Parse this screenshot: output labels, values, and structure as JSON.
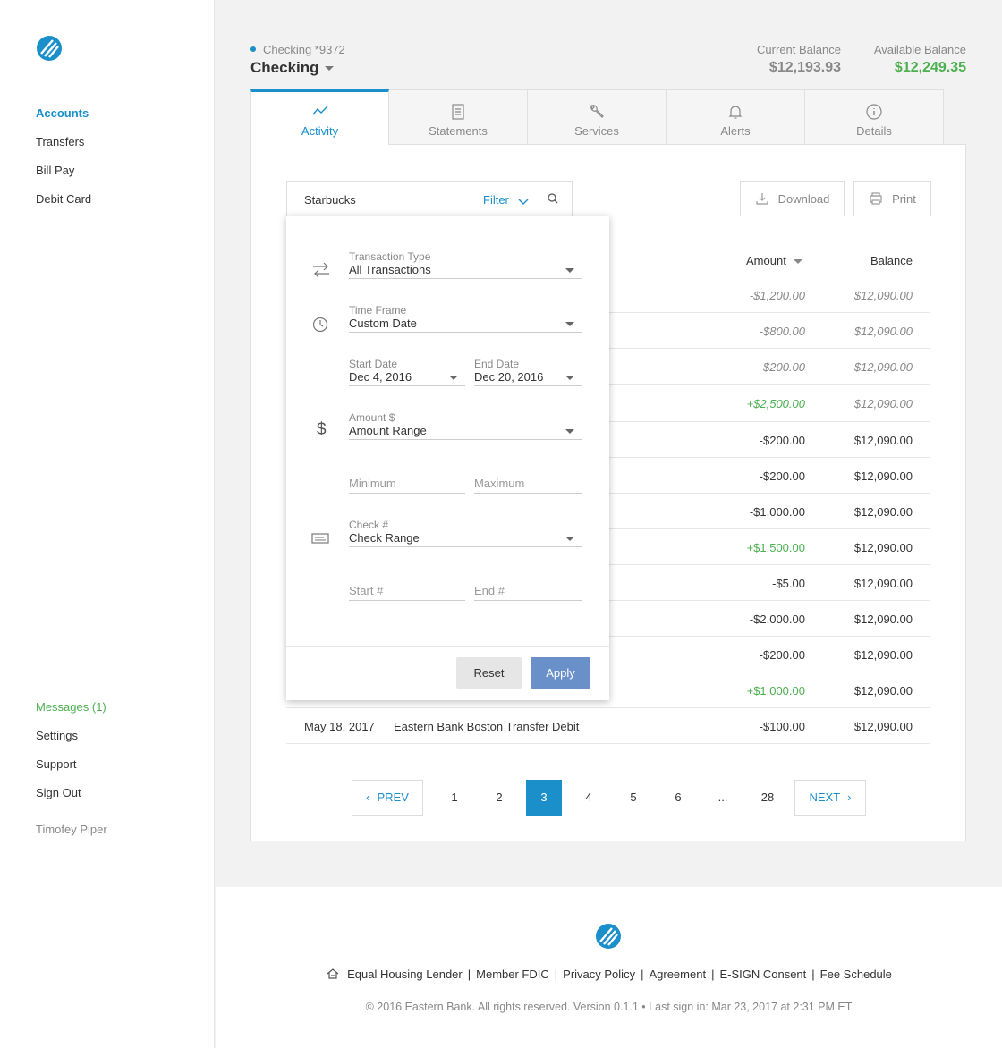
{
  "sidebar": {
    "nav": [
      "Accounts",
      "Transfers",
      "Bill Pay",
      "Debit Card"
    ],
    "bottom": [
      "Messages (1)",
      "Settings",
      "Support",
      "Sign Out"
    ],
    "user": "Timofey Piper"
  },
  "account": {
    "sub": "Checking *9372",
    "name": "Checking",
    "current_label": "Current Balance",
    "current_value": "$12,193.93",
    "available_label": "Available Balance",
    "available_value": "$12,249.35"
  },
  "tabs": [
    "Activity",
    "Statements",
    "Services",
    "Alerts",
    "Details"
  ],
  "search": {
    "value": "Starbucks",
    "filter_label": "Filter"
  },
  "actions": {
    "download": "Download",
    "print": "Print"
  },
  "table": {
    "amount_header": "Amount",
    "balance_header": "Balance",
    "rows": [
      {
        "amount": "-$1,200.00",
        "balance": "$12,090.00"
      },
      {
        "amount": "-$800.00",
        "balance": "$12,090.00"
      },
      {
        "amount": "-$200.00",
        "balance": "$12,090.00"
      },
      {
        "amount": "+$2,500.00",
        "balance": "$12,090.00"
      },
      {
        "amount": "-$200.00",
        "balance": "$12,090.00"
      },
      {
        "amount": "-$200.00",
        "balance": "$12,090.00"
      },
      {
        "amount": "-$1,000.00",
        "balance": "$12,090.00"
      },
      {
        "amount": "+$1,500.00",
        "balance": "$12,090.00"
      },
      {
        "amount": "-$5.00",
        "balance": "$12,090.00"
      },
      {
        "amount": "-$2,000.00",
        "balance": "$12,090.00"
      },
      {
        "amount": "-$200.00",
        "balance": "$12,090.00"
      },
      {
        "amount": "+$1,000.00",
        "balance": "$12,090.00"
      },
      {
        "date": "May 18, 2017",
        "description": "Eastern Bank Boston Transfer Debit",
        "amount": "-$100.00",
        "balance": "$12,090.00"
      }
    ]
  },
  "pagination": {
    "prev": "PREV",
    "next": "NEXT",
    "pages": [
      "1",
      "2",
      "3",
      "4",
      "5",
      "6",
      "...",
      "28"
    ],
    "current": "3"
  },
  "filter": {
    "type_label": "Transaction Type",
    "type_value": "All Transactions",
    "time_label": "Time Frame",
    "time_value": "Custom Date",
    "start_label": "Start Date",
    "start_value": "Dec 4, 2016",
    "end_label": "End Date",
    "end_value": "Dec 20, 2016",
    "amount_label": "Amount $",
    "amount_value": "Amount Range",
    "min_placeholder": "Minimum",
    "max_placeholder": "Maximum",
    "check_label": "Check #",
    "check_value": "Check Range",
    "start_check_placeholder": "Start #",
    "end_check_placeholder": "End #",
    "reset": "Reset",
    "apply": "Apply"
  },
  "footer": {
    "links": [
      "Equal Housing Lender",
      "Member FDIC",
      "Privacy Policy",
      "Agreement",
      "E-SIGN Consent",
      "Fee Schedule"
    ],
    "copyright": "© 2016 Eastern Bank. All rights reserved. Version 0.1.1 • Last sign in: Mar 23, 2017 at 2:31 PM ET"
  },
  "colors": {
    "accent": "#1a8fc9",
    "positive": "#4caf50",
    "apply": "#6a90c9"
  }
}
